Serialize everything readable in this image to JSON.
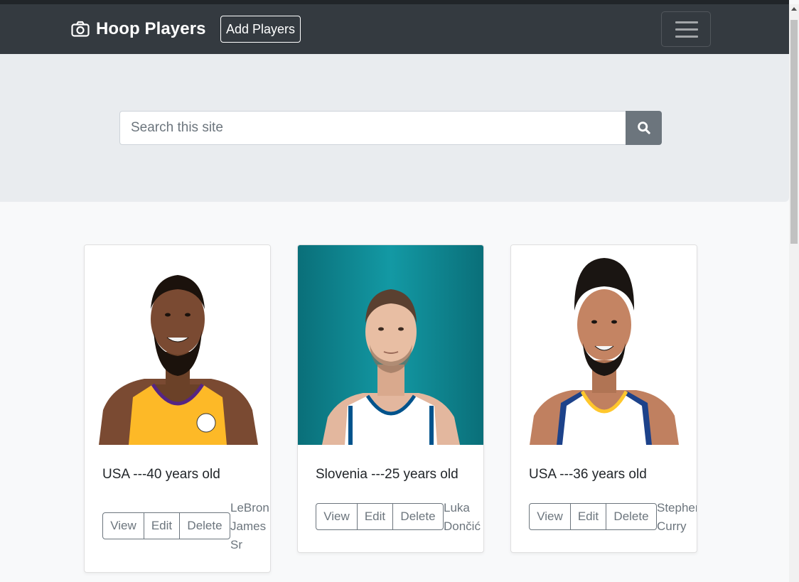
{
  "navbar": {
    "brand": "Hoop Players",
    "brand_icon": "camera-icon",
    "add_button": "Add Players",
    "toggler_icon": "hamburger-icon"
  },
  "search": {
    "placeholder": "Search this site",
    "button_icon": "search-icon"
  },
  "players": [
    {
      "info": "USA ---40 years old",
      "name_lines": [
        "LeBron",
        "James",
        "Sr"
      ],
      "photo_bg": "#ffffff",
      "jersey": "#fdb927"
    },
    {
      "info": "Slovenia ---25 years old",
      "name_lines": [
        "Luka",
        "Dončić"
      ],
      "photo_bg": "#0f8a95",
      "jersey": "#ffffff"
    },
    {
      "info": "USA ---36 years old",
      "name_lines": [
        "Stephen",
        "Curry"
      ],
      "photo_bg": "#ffffff",
      "jersey": "#ffffff"
    }
  ],
  "card_buttons": {
    "view": "View",
    "edit": "Edit",
    "delete": "Delete"
  },
  "colors": {
    "navbar": "#343a40",
    "jumbotron": "#e9ecef",
    "secondary": "#6c757d",
    "page": "#f8f9fa"
  }
}
